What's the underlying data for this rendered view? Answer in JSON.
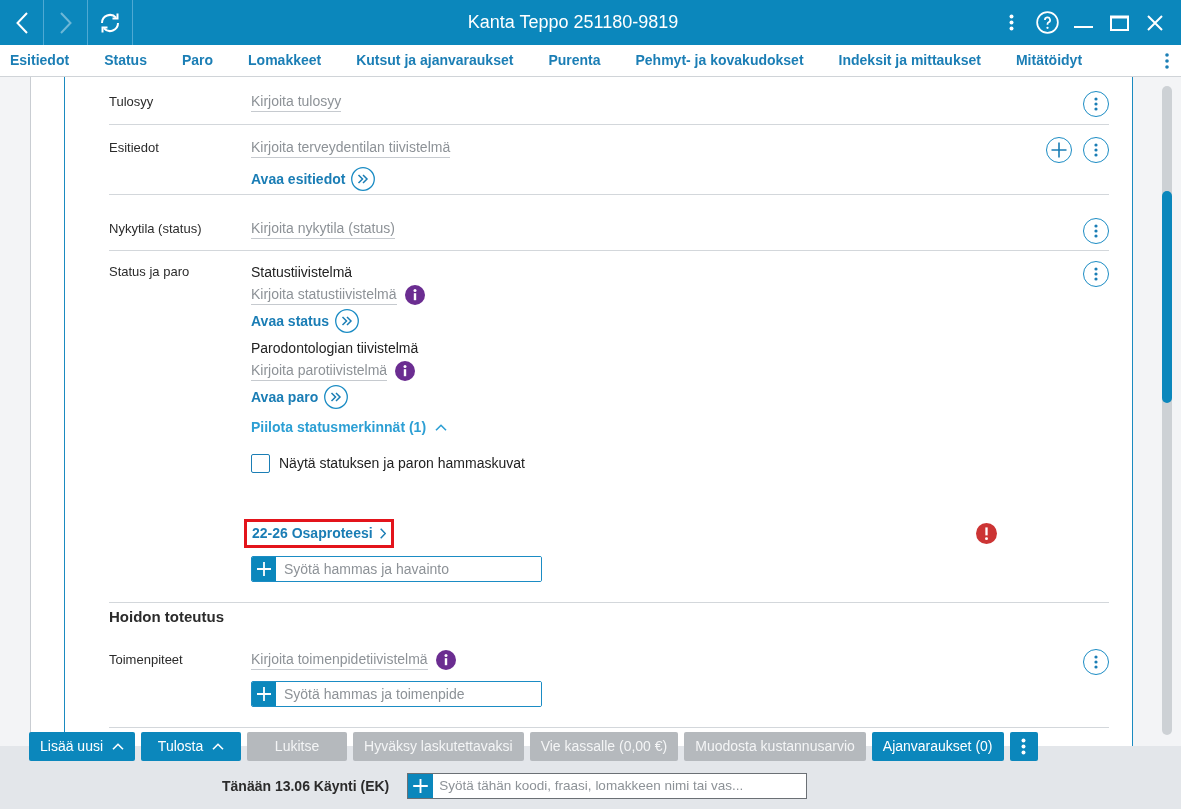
{
  "window": {
    "title": "Kanta Teppo 251180-9819"
  },
  "navigation": [
    {
      "kind": "back",
      "disabled": false
    },
    {
      "kind": "forward",
      "disabled": true
    },
    {
      "kind": "refresh",
      "disabled": false
    }
  ],
  "tabs": [
    "Esitiedot",
    "Status",
    "Paro",
    "Lomakkeet",
    "Kutsut ja ajanvaraukset",
    "Purenta",
    "Pehmyt- ja kovakudokset",
    "Indeksit ja mittaukset",
    "Mitätöidyt"
  ],
  "form": {
    "rows": [
      {
        "kind": "field",
        "label": "Tulosyy",
        "parts": [
          {
            "kind": "summary",
            "placeholder": "Kirjoita tulosyy"
          }
        ]
      },
      {
        "kind": "field",
        "label": "Esitiedot",
        "add_button": true,
        "parts": [
          {
            "kind": "summary",
            "placeholder": "Kirjoita terveydentilan tiivistelmä"
          },
          {
            "kind": "link",
            "label": "Avaa esitiedot"
          }
        ]
      },
      {
        "kind": "field",
        "label": "Nykytila (status)",
        "parts": [
          {
            "kind": "summary",
            "placeholder": "Kirjoita nykytila (status)"
          }
        ]
      },
      {
        "kind": "field",
        "label": "Status ja paro",
        "parts": [
          {
            "kind": "heading",
            "text": "Statustiivistelmä"
          },
          {
            "kind": "summary",
            "placeholder": "Kirjoita statustiivistelmä",
            "info": true
          },
          {
            "kind": "link",
            "label": "Avaa status"
          },
          {
            "kind": "heading",
            "text": "Parodontologian tiivistelmä"
          },
          {
            "kind": "summary",
            "placeholder": "Kirjoita parotiivistelmä",
            "info": true
          },
          {
            "kind": "link",
            "label": "Avaa paro"
          },
          {
            "kind": "toggle",
            "label": "Piilota statusmerkinnät (1)",
            "expanded": true
          },
          {
            "kind": "checkbox",
            "label": "Näytä statuksen ja paron hammaskuvat",
            "checked": false
          },
          {
            "kind": "finding",
            "label": "22-26 Osaproteesi",
            "highlighted": true,
            "error": true
          },
          {
            "kind": "entry",
            "placeholder": "Syötä hammas ja havainto"
          }
        ]
      },
      {
        "kind": "heading",
        "title": "Hoidon toteutus"
      },
      {
        "kind": "field",
        "label": "Toimenpiteet",
        "parts": [
          {
            "kind": "summary",
            "placeholder": "Kirjoita toimenpidetiivistelmä",
            "info": true
          },
          {
            "kind": "entry",
            "placeholder": "Syötä hammas ja toimenpide"
          }
        ]
      }
    ]
  },
  "toolbar": {
    "buttons": [
      {
        "label": "Lisää uusi",
        "disabled": false,
        "menu": true
      },
      {
        "label": "Tulosta",
        "disabled": false,
        "menu": true
      },
      {
        "label": "Lukitse",
        "disabled": true
      },
      {
        "label": "Hyväksy laskutettavaksi",
        "disabled": true
      },
      {
        "label": "Vie kassalle (0,00 €)",
        "disabled": true
      },
      {
        "label": "Muodosta kustannusarvio",
        "disabled": true
      },
      {
        "label": "Ajanvaraukset (0)",
        "disabled": false
      }
    ]
  },
  "status_bar": {
    "visit": "Tänään 13.06 Käynti (EK)",
    "command_field": {
      "placeholder": "Syötä tähän koodi, fraasi, lomakkeen nimi tai vas..."
    }
  }
}
